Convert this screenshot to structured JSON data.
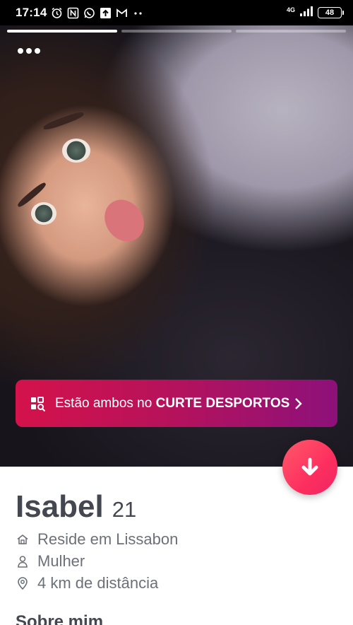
{
  "status_bar": {
    "time": "17:14",
    "network": "4G",
    "battery": "48",
    "icons": [
      "alarm-icon",
      "nfc-icon",
      "whatsapp-icon",
      "upload-icon",
      "gmail-icon",
      "more-dots-icon",
      "signal-icon"
    ]
  },
  "photo": {
    "story_count": 3,
    "active_story": 1
  },
  "shared_interest": {
    "prefix": "Estão ambos no ",
    "highlight": "CURTE DESPORTOS",
    "icon": "explore-search-icon"
  },
  "profile": {
    "name": "Isabel",
    "age": "21",
    "details": [
      {
        "icon": "home-icon",
        "text": "Reside em Lissabon"
      },
      {
        "icon": "person-icon",
        "text": "Mulher"
      },
      {
        "icon": "location-pin-icon",
        "text": "4 km de distância"
      }
    ],
    "about_title": "Sobre mim"
  },
  "colors": {
    "banner_start": "#d4124b",
    "banner_end": "#8d117a",
    "action_button": "#fd2f5f",
    "name_text": "#44474f",
    "detail_text": "#6c7079"
  }
}
